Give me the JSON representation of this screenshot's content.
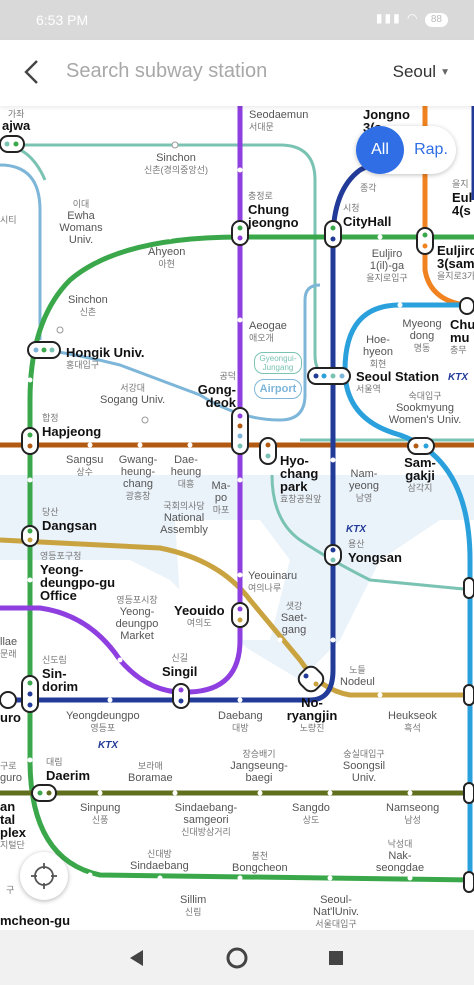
{
  "status_bar": {
    "time": "6:53 PM",
    "battery": "88"
  },
  "search": {
    "placeholder": "Search subway station",
    "region": "Seoul"
  },
  "filter": {
    "all_label": "All",
    "rapid_label": "Rap."
  },
  "colors": {
    "line1": "#233b98",
    "line2": "#3aa84a",
    "line3": "#f0831f",
    "line4": "#2aa0dc",
    "line5": "#8f3fe0",
    "line6": "#b35a12",
    "line7": "#5f6f1d",
    "line9": "#c9a33f",
    "gyeongui": "#7ac3b3",
    "airport": "#7eb6d9",
    "active": "#2f6ee5"
  },
  "stations": {
    "gajwa": {
      "ko": "가좌",
      "en": "ajwa"
    },
    "seodaemun": {
      "en": "Seodaemun",
      "ko": "서대문"
    },
    "jongno3": {
      "en": "Jongno 3(s"
    },
    "sinchon_gyeongui": {
      "en": "Sinchon",
      "ko": "신촌(경의중앙선)"
    },
    "ewha": {
      "ko": "이대",
      "en": "Ewha Womans Univ."
    },
    "sicheong_left": {
      "ko": "시티"
    },
    "chungjeongno": {
      "ko": "충정로",
      "en": "Chung jeongno"
    },
    "cityhall": {
      "ko": "시청",
      "en": "CityHall"
    },
    "euljiro4": {
      "ko": "을지",
      "en": "Eul 4(s"
    },
    "jonggak": {
      "ko": "종각"
    },
    "ahyeon": {
      "en": "Ahyeon",
      "ko": "아현"
    },
    "euljiro1": {
      "en": "Euljiro 1(il)-ga",
      "ko": "을지로입구"
    },
    "euljiro3": {
      "en": "Euljiro 3(sam",
      "ko": "을지로3가"
    },
    "sinchon2": {
      "en": "Sinchon",
      "ko": "신촌"
    },
    "aeogae": {
      "en": "Aeogae",
      "ko": "애오개"
    },
    "myeongdong": {
      "en": "Myeong dong",
      "ko": "명동"
    },
    "chungmuro": {
      "en": "Chu mu",
      "ko": "충무"
    },
    "hongik": {
      "en": "Hongik Univ.",
      "ko": "홍대입구"
    },
    "hoehyeon": {
      "en": "Hoe- hyeon",
      "ko": "회현"
    },
    "gyeongui_badge": {
      "text": "Gyeongui- Jungang"
    },
    "airport_badge": {
      "text": "Airport"
    },
    "seoulstation": {
      "en": "Seoul Station",
      "ko": "서울역"
    },
    "ktx1": {
      "text": "KTX"
    },
    "gongdeok": {
      "ko": "공덕",
      "en": "Gong- deok"
    },
    "sogang": {
      "ko": "서강대",
      "en": "Sogang Univ."
    },
    "sookmyung": {
      "ko": "숙대입구",
      "en": "Sookmyung Women's Univ."
    },
    "hapjeong": {
      "ko": "합정",
      "en": "Hapjeong"
    },
    "sangsu": {
      "en": "Sangsu",
      "ko": "상수"
    },
    "gwangheung": {
      "en": "Gwang- heung- chang",
      "ko": "광흥창"
    },
    "daeheung": {
      "en": "Dae- heung",
      "ko": "대흥"
    },
    "hyochang": {
      "en": "Hyo- chang park",
      "ko": "효창공원앞"
    },
    "samgakji": {
      "en": "Sam- gakji",
      "ko": "삼각지"
    },
    "mapo": {
      "en": "Ma- po",
      "ko": "마포"
    },
    "namyeong": {
      "en": "Nam- yeong",
      "ko": "남영"
    },
    "national_assembly": {
      "ko": "국회의사당",
      "en": "National Assembly"
    },
    "dangsan": {
      "ko": "당산",
      "en": "Dangsan"
    },
    "ktx2": {
      "text": "KTX"
    },
    "yongsan": {
      "ko": "용산",
      "en": "Yongsan"
    },
    "yeongdeungpogu": {
      "ko": "영등포구청",
      "en": "Yeong- deungpo-gu Office"
    },
    "yeongdeungpo_market": {
      "ko": "영등포시장",
      "en": "Yeong- deungpo Market"
    },
    "yeouinaru": {
      "en": "Yeouinaru",
      "ko": "여의나루"
    },
    "yeouido": {
      "en": "Yeouido",
      "ko": "여의도"
    },
    "saetgang": {
      "ko": "샛강",
      "en": "Saet- gang"
    },
    "mullae": {
      "en": "llae",
      "ko": "문래"
    },
    "sindorim": {
      "ko": "신도림",
      "en": "Sin- dorim"
    },
    "singil": {
      "ko": "신길",
      "en": "Singil"
    },
    "nodeul": {
      "ko": "노들",
      "en": "Nodeul"
    },
    "guro": {
      "en": "uro"
    },
    "yeongdeungpo": {
      "en": "Yeongdeungpo",
      "ko": "영등포"
    },
    "daebang": {
      "en": "Daebang",
      "ko": "대방"
    },
    "noryangjin": {
      "en": "No- ryangjin",
      "ko": "노량진"
    },
    "heukseok": {
      "en": "Heukseok",
      "ko": "흑석"
    },
    "ktx3": {
      "text": "KTX"
    },
    "guro_digital": {
      "ko": "구로",
      "en": "guro"
    },
    "daerim": {
      "ko": "대림",
      "en": "Daerim"
    },
    "boramae": {
      "ko": "보라매",
      "en": "Boramae"
    },
    "jangseungbaegi": {
      "ko": "장승배기",
      "en": "Jangseung- baegi"
    },
    "soongsil": {
      "ko": "숭실대입구",
      "en": "Soongsil Univ."
    },
    "digital_complex": {
      "en": "an tal plex",
      "ko": "지털단"
    },
    "sinpung": {
      "en": "Sinpung",
      "ko": "신풍"
    },
    "sindaebang_samgeori": {
      "en": "Sindaebang- samgeori",
      "ko": "신대방삼거리"
    },
    "sangdo": {
      "en": "Sangdo",
      "ko": "상도"
    },
    "namseong": {
      "en": "Namseong",
      "ko": "남성"
    },
    "sindaebang": {
      "ko": "신대방",
      "en": "Sindaebang"
    },
    "bongcheon": {
      "ko": "봉천",
      "en": "Bongcheon"
    },
    "naksungdae": {
      "ko": "낙성대",
      "en": "Nak- seongdae"
    },
    "geumcheon_left": {
      "ko": "구"
    },
    "sillim": {
      "en": "Sillim",
      "ko": "신림"
    },
    "snu": {
      "en": "Seoul- Nat'lUniv.",
      "ko": "서울대입구"
    },
    "geumcheongu": {
      "en": "mcheon-gu"
    }
  }
}
